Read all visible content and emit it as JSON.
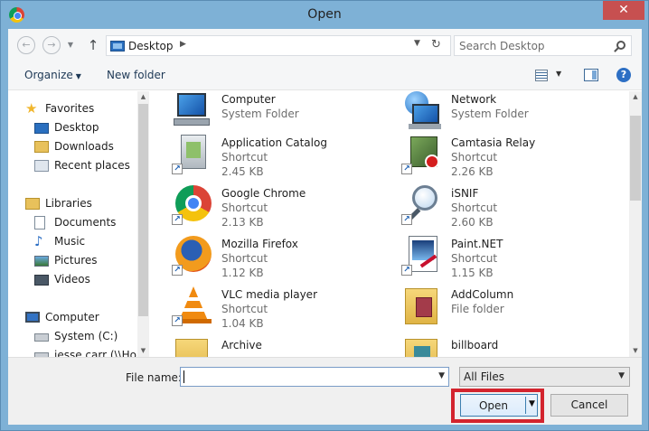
{
  "window": {
    "title": "Open",
    "close_glyph": "✕"
  },
  "address_bar": {
    "location": "Desktop",
    "search_placeholder": "Search Desktop"
  },
  "toolbar": {
    "organize_label": "Organize",
    "new_folder_label": "New folder",
    "help_glyph": "?"
  },
  "nav": {
    "items": [
      {
        "label": "Favorites",
        "icon": "star-icon"
      },
      {
        "label": "Desktop",
        "icon": "desktop-icon"
      },
      {
        "label": "Downloads",
        "icon": "downloads-icon"
      },
      {
        "label": "Recent places",
        "icon": "recent-places-icon"
      },
      {
        "label": "Libraries",
        "icon": "libraries-icon"
      },
      {
        "label": "Documents",
        "icon": "documents-icon"
      },
      {
        "label": "Music",
        "icon": "music-icon"
      },
      {
        "label": "Pictures",
        "icon": "pictures-icon"
      },
      {
        "label": "Videos",
        "icon": "videos-icon"
      },
      {
        "label": "Computer",
        "icon": "computer-icon"
      },
      {
        "label": "System (C:)",
        "icon": "drive-icon"
      },
      {
        "label": "jesse.carr (\\\\Hom",
        "icon": "network-drive-icon"
      }
    ]
  },
  "files": [
    {
      "name": "Computer",
      "type": "System Folder",
      "size": "",
      "icon": "computer-icon"
    },
    {
      "name": "Network",
      "type": "System Folder",
      "size": "",
      "icon": "network-icon"
    },
    {
      "name": "Application Catalog",
      "type": "Shortcut",
      "size": "2.45 KB",
      "icon": "application-catalog-icon"
    },
    {
      "name": "Camtasia Relay",
      "type": "Shortcut",
      "size": "2.26 KB",
      "icon": "camtasia-relay-icon"
    },
    {
      "name": "Google Chrome",
      "type": "Shortcut",
      "size": "2.13 KB",
      "icon": "chrome-icon"
    },
    {
      "name": "iSNIF",
      "type": "Shortcut",
      "size": "2.60 KB",
      "icon": "magnifier-icon"
    },
    {
      "name": "Mozilla Firefox",
      "type": "Shortcut",
      "size": "1.12 KB",
      "icon": "firefox-icon"
    },
    {
      "name": "Paint.NET",
      "type": "Shortcut",
      "size": "1.15 KB",
      "icon": "paint-net-icon"
    },
    {
      "name": "VLC media player",
      "type": "Shortcut",
      "size": "1.04 KB",
      "icon": "vlc-icon"
    },
    {
      "name": "AddColumn",
      "type": "File folder",
      "size": "",
      "icon": "folder-icon"
    },
    {
      "name": "Archive",
      "type": "",
      "size": "",
      "icon": "folder-icon"
    },
    {
      "name": "billboard",
      "type": "",
      "size": "",
      "icon": "folder-icon"
    }
  ],
  "bottom": {
    "file_name_label": "File name:",
    "file_name_value": "",
    "filter_value": "All Files",
    "open_label": "Open",
    "cancel_label": "Cancel"
  }
}
